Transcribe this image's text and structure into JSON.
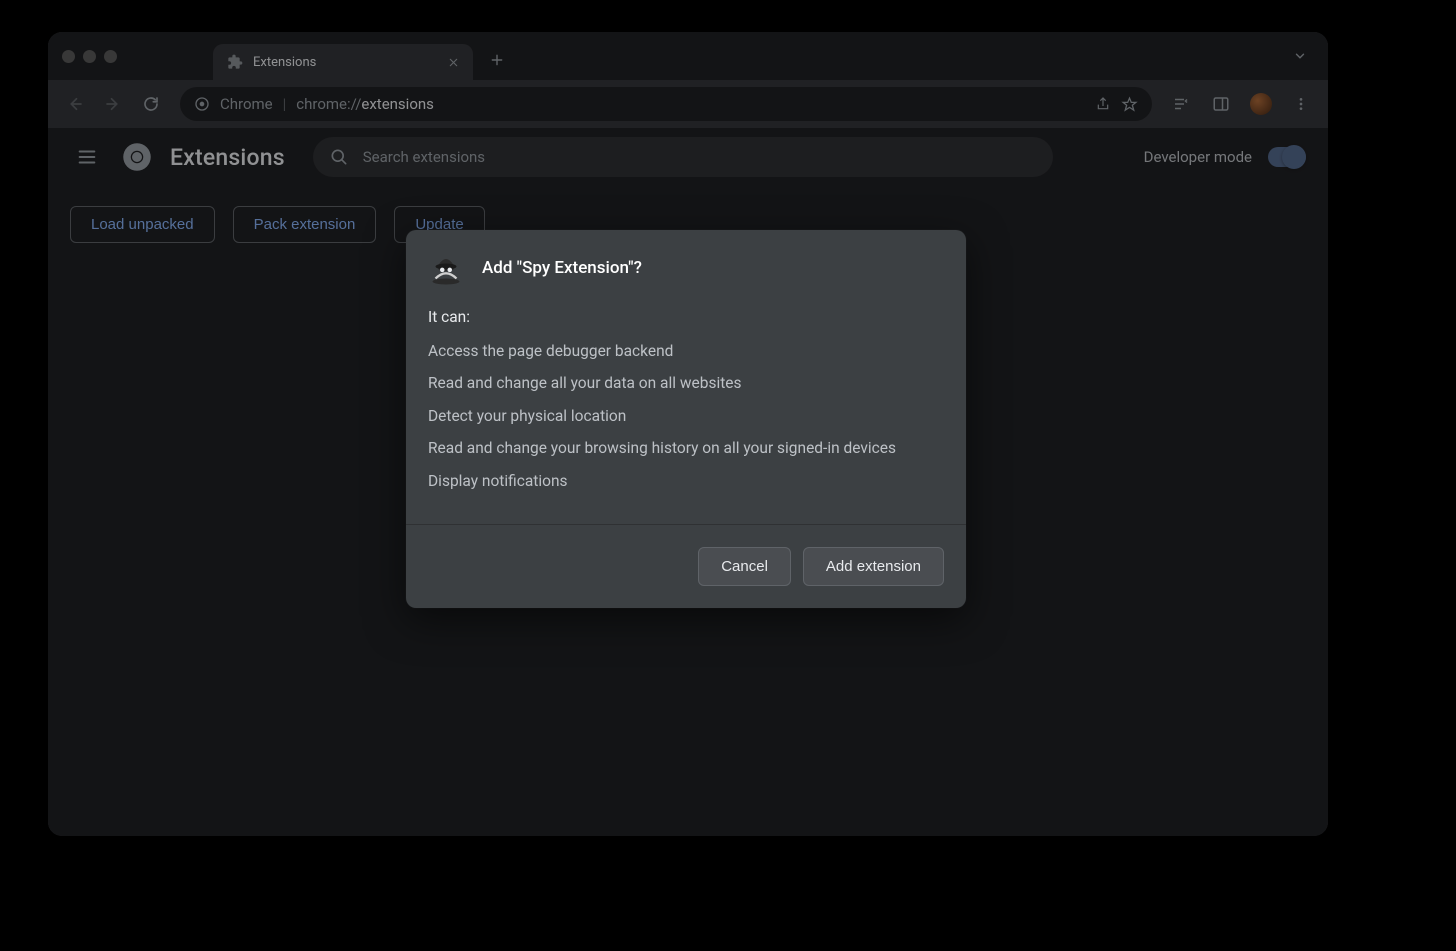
{
  "tab": {
    "title": "Extensions"
  },
  "omnibox": {
    "app_label": "Chrome",
    "url_prefix": "chrome://",
    "url_suffix": "extensions"
  },
  "page": {
    "title": "Extensions",
    "search_placeholder": "Search extensions",
    "dev_mode_label": "Developer mode",
    "buttons": {
      "load_unpacked": "Load unpacked",
      "pack_extension": "Pack extension",
      "update": "Update"
    }
  },
  "dialog": {
    "title": "Add \"Spy Extension\"?",
    "it_can": "It can:",
    "permissions": [
      "Access the page debugger backend",
      "Read and change all your data on all websites",
      "Detect your physical location",
      "Read and change your browsing history on all your signed-in devices",
      "Display notifications"
    ],
    "cancel": "Cancel",
    "confirm": "Add extension"
  }
}
